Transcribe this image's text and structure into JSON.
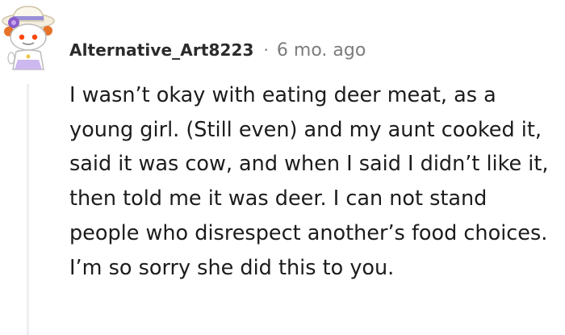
{
  "comment": {
    "author": "Alternative_Art8223",
    "separator": "·",
    "timestamp": "6 mo. ago",
    "avatar_icon": "snoo-avatar-icon",
    "body": "I wasn’t okay with eating deer meat, as a young girl. (Still even) and my aunt cooked it, said it was cow, and when I said I didn’t like it, then told me it was deer. I can not stand people who disrespect another’s food choices. I’m so sorry she did this to you."
  },
  "colors": {
    "username": "#2b2b2c",
    "meta": "#7c7c7c",
    "body": "#1c1c1c",
    "thread_line": "#edeff1"
  }
}
